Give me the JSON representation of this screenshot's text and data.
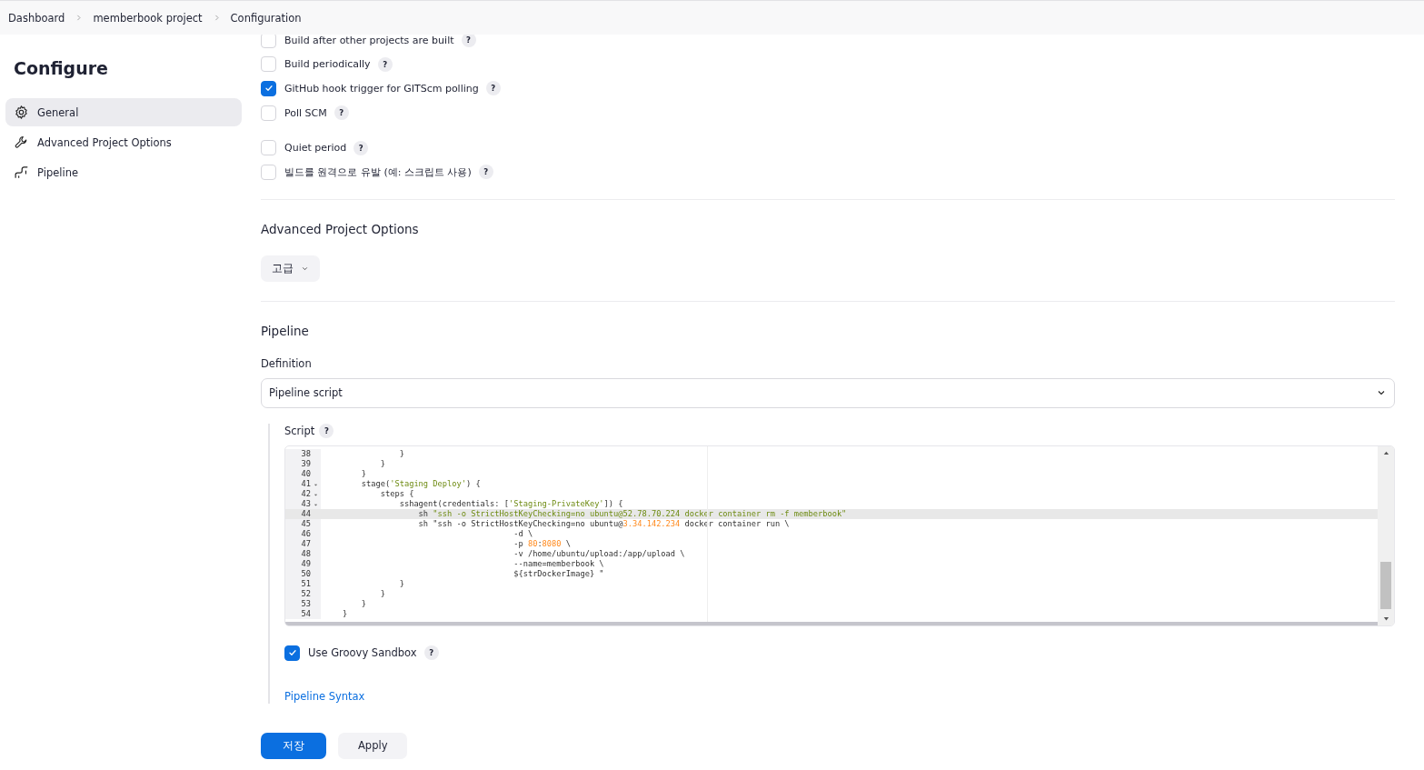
{
  "breadcrumbs": [
    {
      "label": "Dashboard"
    },
    {
      "label": "memberbook project"
    },
    {
      "label": "Configuration"
    }
  ],
  "sidebar": {
    "title": "Configure",
    "items": [
      {
        "label": "General",
        "selected": true
      },
      {
        "label": "Advanced Project Options",
        "selected": false
      },
      {
        "label": "Pipeline",
        "selected": false
      }
    ]
  },
  "build_triggers": [
    {
      "label": "Build after other projects are built",
      "checked": false,
      "help": "?"
    },
    {
      "label": "Build periodically",
      "checked": false,
      "help": "?"
    },
    {
      "label": "GitHub hook trigger for GITScm polling",
      "checked": true,
      "help": "?"
    },
    {
      "label": "Poll SCM",
      "checked": false,
      "help": "?"
    }
  ],
  "options": [
    {
      "label": "Quiet period",
      "checked": false,
      "help": "?"
    },
    {
      "label": "빌드를 원격으로 유발 (예: 스크립트 사용)",
      "checked": false,
      "help": "?"
    }
  ],
  "advanced_section": {
    "title": "Advanced Project Options",
    "button": "고급"
  },
  "pipeline_section": {
    "title": "Pipeline",
    "definition_label": "Definition",
    "definition_value": "Pipeline script",
    "script_label": "Script",
    "script_help": "?",
    "script_lines": [
      {
        "number": "38",
        "foldable": false,
        "active": false,
        "segments": [
          {
            "kind": "plain",
            "text": "                }"
          }
        ]
      },
      {
        "number": "39",
        "foldable": false,
        "active": false,
        "segments": [
          {
            "kind": "plain",
            "text": "            }"
          }
        ]
      },
      {
        "number": "40",
        "foldable": false,
        "active": false,
        "segments": [
          {
            "kind": "plain",
            "text": "        }"
          }
        ]
      },
      {
        "number": "41",
        "foldable": true,
        "active": false,
        "segments": [
          {
            "kind": "plain",
            "text": "        stage("
          },
          {
            "kind": "string",
            "text": "'Staging Deploy'"
          },
          {
            "kind": "plain",
            "text": ") {"
          }
        ]
      },
      {
        "number": "42",
        "foldable": true,
        "active": false,
        "segments": [
          {
            "kind": "plain",
            "text": "            steps {"
          }
        ]
      },
      {
        "number": "43",
        "foldable": true,
        "active": false,
        "segments": [
          {
            "kind": "plain",
            "text": "                sshagent(credentials: ["
          },
          {
            "kind": "string",
            "text": "'Staging-PrivateKey'"
          },
          {
            "kind": "plain",
            "text": "]) {"
          }
        ]
      },
      {
        "number": "44",
        "foldable": false,
        "active": true,
        "segments": [
          {
            "kind": "plain",
            "text": "                    sh "
          },
          {
            "kind": "string",
            "text": "\"ssh -o StrictHostKeyChecking=no ubuntu@52.78.70.224 docker container rm -f memberbook\""
          }
        ]
      },
      {
        "number": "45",
        "foldable": false,
        "active": false,
        "segments": [
          {
            "kind": "plain",
            "text": "                    sh \"ssh -o StrictHostKeyChecking=no ubuntu@"
          },
          {
            "kind": "number",
            "text": "3.34.142.234"
          },
          {
            "kind": "plain",
            "text": " docker container run \\"
          }
        ]
      },
      {
        "number": "46",
        "foldable": false,
        "active": false,
        "segments": [
          {
            "kind": "plain",
            "text": "                                        -d \\"
          }
        ]
      },
      {
        "number": "47",
        "foldable": false,
        "active": false,
        "segments": [
          {
            "kind": "plain",
            "text": "                                        -p "
          },
          {
            "kind": "number",
            "text": "80"
          },
          {
            "kind": "plain",
            "text": ":"
          },
          {
            "kind": "number",
            "text": "8080"
          },
          {
            "kind": "plain",
            "text": " \\"
          }
        ]
      },
      {
        "number": "48",
        "foldable": false,
        "active": false,
        "segments": [
          {
            "kind": "plain",
            "text": "                                        -v /home/ubuntu/upload:/app/upload \\"
          }
        ]
      },
      {
        "number": "49",
        "foldable": false,
        "active": false,
        "segments": [
          {
            "kind": "plain",
            "text": "                                        --name=memberbook \\"
          }
        ]
      },
      {
        "number": "50",
        "foldable": false,
        "active": false,
        "segments": [
          {
            "kind": "plain",
            "text": "                                        ${strDockerImage} \""
          }
        ]
      },
      {
        "number": "51",
        "foldable": false,
        "active": false,
        "segments": [
          {
            "kind": "plain",
            "text": "                }"
          }
        ]
      },
      {
        "number": "52",
        "foldable": false,
        "active": false,
        "segments": [
          {
            "kind": "plain",
            "text": "            }"
          }
        ]
      },
      {
        "number": "53",
        "foldable": false,
        "active": false,
        "segments": [
          {
            "kind": "plain",
            "text": "        }"
          }
        ]
      },
      {
        "number": "54",
        "foldable": false,
        "active": false,
        "segments": [
          {
            "kind": "plain",
            "text": "    }"
          }
        ]
      }
    ],
    "sandbox": {
      "label": "Use Groovy Sandbox",
      "checked": true,
      "help": "?"
    },
    "syntax_link": "Pipeline Syntax"
  },
  "buttons": [
    {
      "label": "저장",
      "kind": "primary"
    },
    {
      "label": "Apply",
      "kind": "secondary"
    }
  ]
}
